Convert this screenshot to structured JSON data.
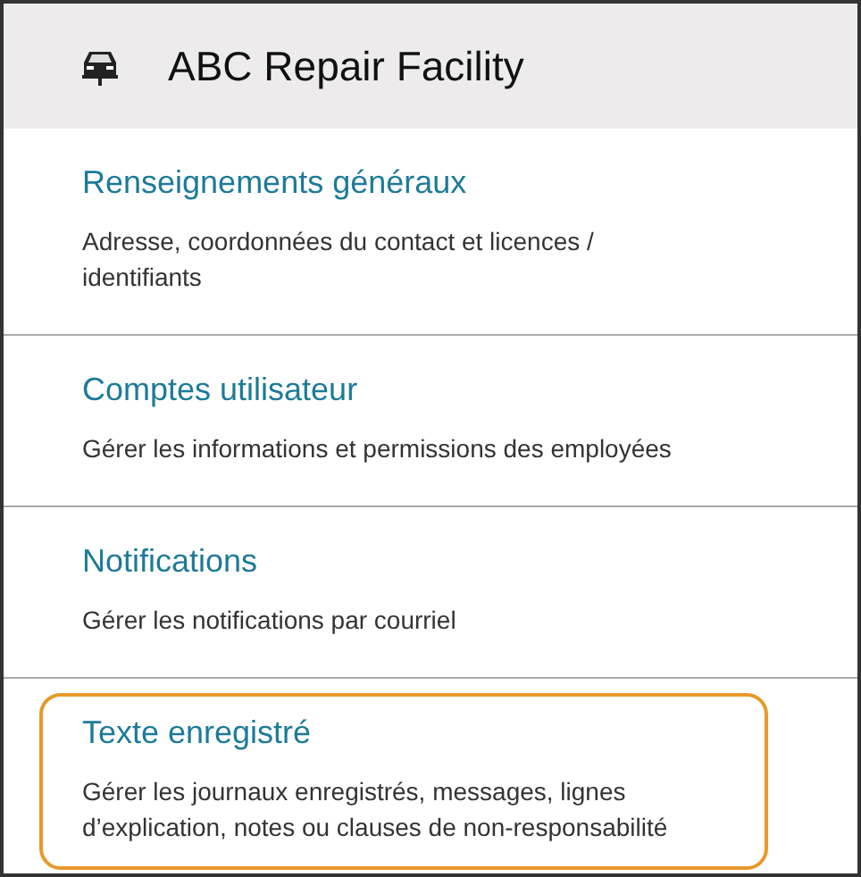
{
  "header": {
    "title": "ABC Repair Facility"
  },
  "items": [
    {
      "title": "Renseignements généraux",
      "description_lines": [
        "Adresse, coordonnées du contact et licences /",
        "identifiants"
      ],
      "selected": false
    },
    {
      "title": "Comptes utilisateur",
      "description_lines": [
        "Gérer les informations et permissions des employées"
      ],
      "selected": false
    },
    {
      "title": "Notifications",
      "description_lines": [
        "Gérer les notifications par courriel"
      ],
      "selected": false
    },
    {
      "title": "Texte enregistré",
      "description_lines": [
        "Gérer les journaux enregistrés, messages, lignes",
        "d’explication, notes ou clauses de non-responsabilité"
      ],
      "selected": true
    }
  ]
}
